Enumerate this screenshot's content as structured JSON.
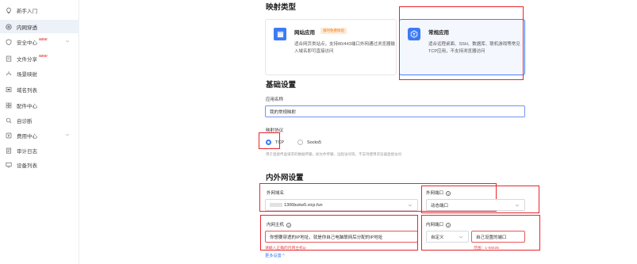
{
  "sidebar": {
    "items": [
      {
        "label": "新手入门",
        "icon": "lightbulb-icon",
        "new": "",
        "chevron": false,
        "active": false
      },
      {
        "label": "内网穿透",
        "icon": "network-icon",
        "new": "",
        "chevron": false,
        "active": true
      },
      {
        "label": "安全中心",
        "icon": "shield-icon",
        "new": "NEW",
        "chevron": true,
        "active": false
      },
      {
        "label": "文件分享",
        "icon": "file-icon",
        "new": "NEW",
        "chevron": false,
        "active": false
      },
      {
        "label": "场景映射",
        "icon": "scene-icon",
        "new": "",
        "chevron": false,
        "active": false
      },
      {
        "label": "域名列表",
        "icon": "domain-icon",
        "new": "",
        "chevron": false,
        "active": false
      },
      {
        "label": "配件中心",
        "icon": "grid-icon",
        "new": "",
        "chevron": false,
        "active": false
      },
      {
        "label": "自诊断",
        "icon": "diagnose-icon",
        "new": "",
        "chevron": false,
        "active": false
      },
      {
        "label": "费用中心",
        "icon": "yuan-icon",
        "new": "",
        "chevron": true,
        "active": false
      },
      {
        "label": "审计日志",
        "icon": "log-icon",
        "new": "",
        "chevron": false,
        "active": false
      },
      {
        "label": "设备列表",
        "icon": "device-icon",
        "new": "",
        "chevron": false,
        "active": false
      }
    ]
  },
  "mapping_type": {
    "title": "映射类型",
    "web": {
      "title": "网站应用",
      "tag": "限时免费体验",
      "desc": "适合网页类站点，支持80/443端口外网通过浏览器输入域名即可直接访问"
    },
    "general": {
      "title": "常规应用",
      "desc": "适合远程桌面、SSH、数据库、联机游戏等常见TCP应用，不支持浏览器访问"
    }
  },
  "basic": {
    "title": "基础设置",
    "app_name_label": "应用名称",
    "app_name_value": "我的常规映射",
    "protocol_label": "映射协议",
    "protocols": [
      "TCP",
      "Socks5"
    ],
    "protocol_hint": "用于直接传送请求的数据传输，如文件传输、远程访问等，不支持使用浏览器直接访问"
  },
  "network": {
    "title": "内外网设置",
    "ext_domain_label": "外网域名",
    "ext_domain_value": "1306bukw5.vicp.fun",
    "ext_port_label": "外网端口",
    "ext_port_value": "动态端口",
    "int_host_label": "内网主机",
    "int_host_placeholder": "你想要穿透的IP地址，就是你自己电脑联网后分配的IP地址",
    "int_host_error": "请输入正确的内网主机ip",
    "int_port_label": "内网端口",
    "int_port_mode": "自定义",
    "int_port_placeholder": "自己设置的端口",
    "int_port_range": "范围：1-65535",
    "more_link": "更多设置 ^"
  },
  "colors": {
    "accent": "#3d7af5",
    "annotation": "#e8262d",
    "error": "#e84a4a"
  }
}
